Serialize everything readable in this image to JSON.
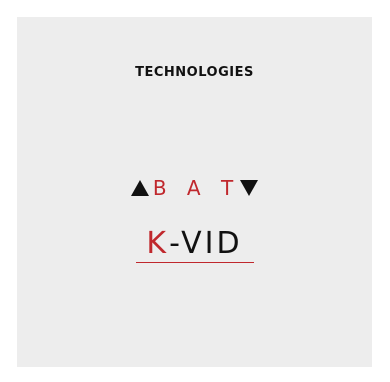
{
  "section": {
    "heading": "TECHNOLOGIES"
  },
  "logos": {
    "abat": {
      "text": "B A T",
      "left_icon": "triangle-up-icon",
      "right_icon": "triangle-down-icon",
      "text_color": "#c0282d",
      "icon_color": "#111111"
    },
    "kvid": {
      "first_letter": "K",
      "rest": "-VID",
      "first_letter_color": "#c0282d",
      "rest_color": "#111111",
      "underline_color": "#c0282d"
    }
  },
  "colors": {
    "card_background": "#ededed",
    "page_background": "#ffffff"
  }
}
